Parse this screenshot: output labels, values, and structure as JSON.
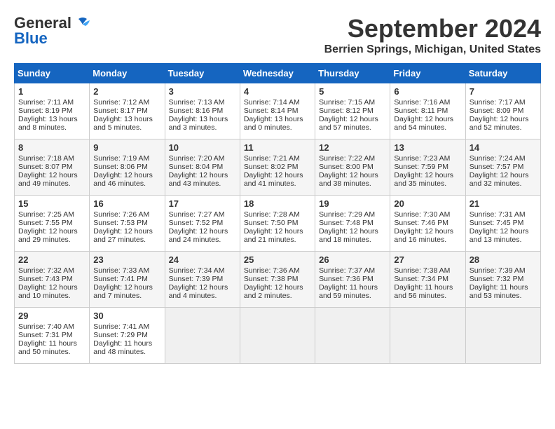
{
  "header": {
    "logo_general": "General",
    "logo_blue": "Blue",
    "month": "September 2024",
    "location": "Berrien Springs, Michigan, United States"
  },
  "calendar": {
    "days_of_week": [
      "Sunday",
      "Monday",
      "Tuesday",
      "Wednesday",
      "Thursday",
      "Friday",
      "Saturday"
    ],
    "weeks": [
      [
        {
          "day": "1",
          "sunrise": "Sunrise: 7:11 AM",
          "sunset": "Sunset: 8:19 PM",
          "daylight": "Daylight: 13 hours and 8 minutes."
        },
        {
          "day": "2",
          "sunrise": "Sunrise: 7:12 AM",
          "sunset": "Sunset: 8:17 PM",
          "daylight": "Daylight: 13 hours and 5 minutes."
        },
        {
          "day": "3",
          "sunrise": "Sunrise: 7:13 AM",
          "sunset": "Sunset: 8:16 PM",
          "daylight": "Daylight: 13 hours and 3 minutes."
        },
        {
          "day": "4",
          "sunrise": "Sunrise: 7:14 AM",
          "sunset": "Sunset: 8:14 PM",
          "daylight": "Daylight: 13 hours and 0 minutes."
        },
        {
          "day": "5",
          "sunrise": "Sunrise: 7:15 AM",
          "sunset": "Sunset: 8:12 PM",
          "daylight": "Daylight: 12 hours and 57 minutes."
        },
        {
          "day": "6",
          "sunrise": "Sunrise: 7:16 AM",
          "sunset": "Sunset: 8:11 PM",
          "daylight": "Daylight: 12 hours and 54 minutes."
        },
        {
          "day": "7",
          "sunrise": "Sunrise: 7:17 AM",
          "sunset": "Sunset: 8:09 PM",
          "daylight": "Daylight: 12 hours and 52 minutes."
        }
      ],
      [
        {
          "day": "8",
          "sunrise": "Sunrise: 7:18 AM",
          "sunset": "Sunset: 8:07 PM",
          "daylight": "Daylight: 12 hours and 49 minutes."
        },
        {
          "day": "9",
          "sunrise": "Sunrise: 7:19 AM",
          "sunset": "Sunset: 8:06 PM",
          "daylight": "Daylight: 12 hours and 46 minutes."
        },
        {
          "day": "10",
          "sunrise": "Sunrise: 7:20 AM",
          "sunset": "Sunset: 8:04 PM",
          "daylight": "Daylight: 12 hours and 43 minutes."
        },
        {
          "day": "11",
          "sunrise": "Sunrise: 7:21 AM",
          "sunset": "Sunset: 8:02 PM",
          "daylight": "Daylight: 12 hours and 41 minutes."
        },
        {
          "day": "12",
          "sunrise": "Sunrise: 7:22 AM",
          "sunset": "Sunset: 8:00 PM",
          "daylight": "Daylight: 12 hours and 38 minutes."
        },
        {
          "day": "13",
          "sunrise": "Sunrise: 7:23 AM",
          "sunset": "Sunset: 7:59 PM",
          "daylight": "Daylight: 12 hours and 35 minutes."
        },
        {
          "day": "14",
          "sunrise": "Sunrise: 7:24 AM",
          "sunset": "Sunset: 7:57 PM",
          "daylight": "Daylight: 12 hours and 32 minutes."
        }
      ],
      [
        {
          "day": "15",
          "sunrise": "Sunrise: 7:25 AM",
          "sunset": "Sunset: 7:55 PM",
          "daylight": "Daylight: 12 hours and 29 minutes."
        },
        {
          "day": "16",
          "sunrise": "Sunrise: 7:26 AM",
          "sunset": "Sunset: 7:53 PM",
          "daylight": "Daylight: 12 hours and 27 minutes."
        },
        {
          "day": "17",
          "sunrise": "Sunrise: 7:27 AM",
          "sunset": "Sunset: 7:52 PM",
          "daylight": "Daylight: 12 hours and 24 minutes."
        },
        {
          "day": "18",
          "sunrise": "Sunrise: 7:28 AM",
          "sunset": "Sunset: 7:50 PM",
          "daylight": "Daylight: 12 hours and 21 minutes."
        },
        {
          "day": "19",
          "sunrise": "Sunrise: 7:29 AM",
          "sunset": "Sunset: 7:48 PM",
          "daylight": "Daylight: 12 hours and 18 minutes."
        },
        {
          "day": "20",
          "sunrise": "Sunrise: 7:30 AM",
          "sunset": "Sunset: 7:46 PM",
          "daylight": "Daylight: 12 hours and 16 minutes."
        },
        {
          "day": "21",
          "sunrise": "Sunrise: 7:31 AM",
          "sunset": "Sunset: 7:45 PM",
          "daylight": "Daylight: 12 hours and 13 minutes."
        }
      ],
      [
        {
          "day": "22",
          "sunrise": "Sunrise: 7:32 AM",
          "sunset": "Sunset: 7:43 PM",
          "daylight": "Daylight: 12 hours and 10 minutes."
        },
        {
          "day": "23",
          "sunrise": "Sunrise: 7:33 AM",
          "sunset": "Sunset: 7:41 PM",
          "daylight": "Daylight: 12 hours and 7 minutes."
        },
        {
          "day": "24",
          "sunrise": "Sunrise: 7:34 AM",
          "sunset": "Sunset: 7:39 PM",
          "daylight": "Daylight: 12 hours and 4 minutes."
        },
        {
          "day": "25",
          "sunrise": "Sunrise: 7:36 AM",
          "sunset": "Sunset: 7:38 PM",
          "daylight": "Daylight: 12 hours and 2 minutes."
        },
        {
          "day": "26",
          "sunrise": "Sunrise: 7:37 AM",
          "sunset": "Sunset: 7:36 PM",
          "daylight": "Daylight: 11 hours and 59 minutes."
        },
        {
          "day": "27",
          "sunrise": "Sunrise: 7:38 AM",
          "sunset": "Sunset: 7:34 PM",
          "daylight": "Daylight: 11 hours and 56 minutes."
        },
        {
          "day": "28",
          "sunrise": "Sunrise: 7:39 AM",
          "sunset": "Sunset: 7:32 PM",
          "daylight": "Daylight: 11 hours and 53 minutes."
        }
      ],
      [
        {
          "day": "29",
          "sunrise": "Sunrise: 7:40 AM",
          "sunset": "Sunset: 7:31 PM",
          "daylight": "Daylight: 11 hours and 50 minutes."
        },
        {
          "day": "30",
          "sunrise": "Sunrise: 7:41 AM",
          "sunset": "Sunset: 7:29 PM",
          "daylight": "Daylight: 11 hours and 48 minutes."
        },
        {
          "day": "",
          "sunrise": "",
          "sunset": "",
          "daylight": ""
        },
        {
          "day": "",
          "sunrise": "",
          "sunset": "",
          "daylight": ""
        },
        {
          "day": "",
          "sunrise": "",
          "sunset": "",
          "daylight": ""
        },
        {
          "day": "",
          "sunrise": "",
          "sunset": "",
          "daylight": ""
        },
        {
          "day": "",
          "sunrise": "",
          "sunset": "",
          "daylight": ""
        }
      ]
    ]
  }
}
